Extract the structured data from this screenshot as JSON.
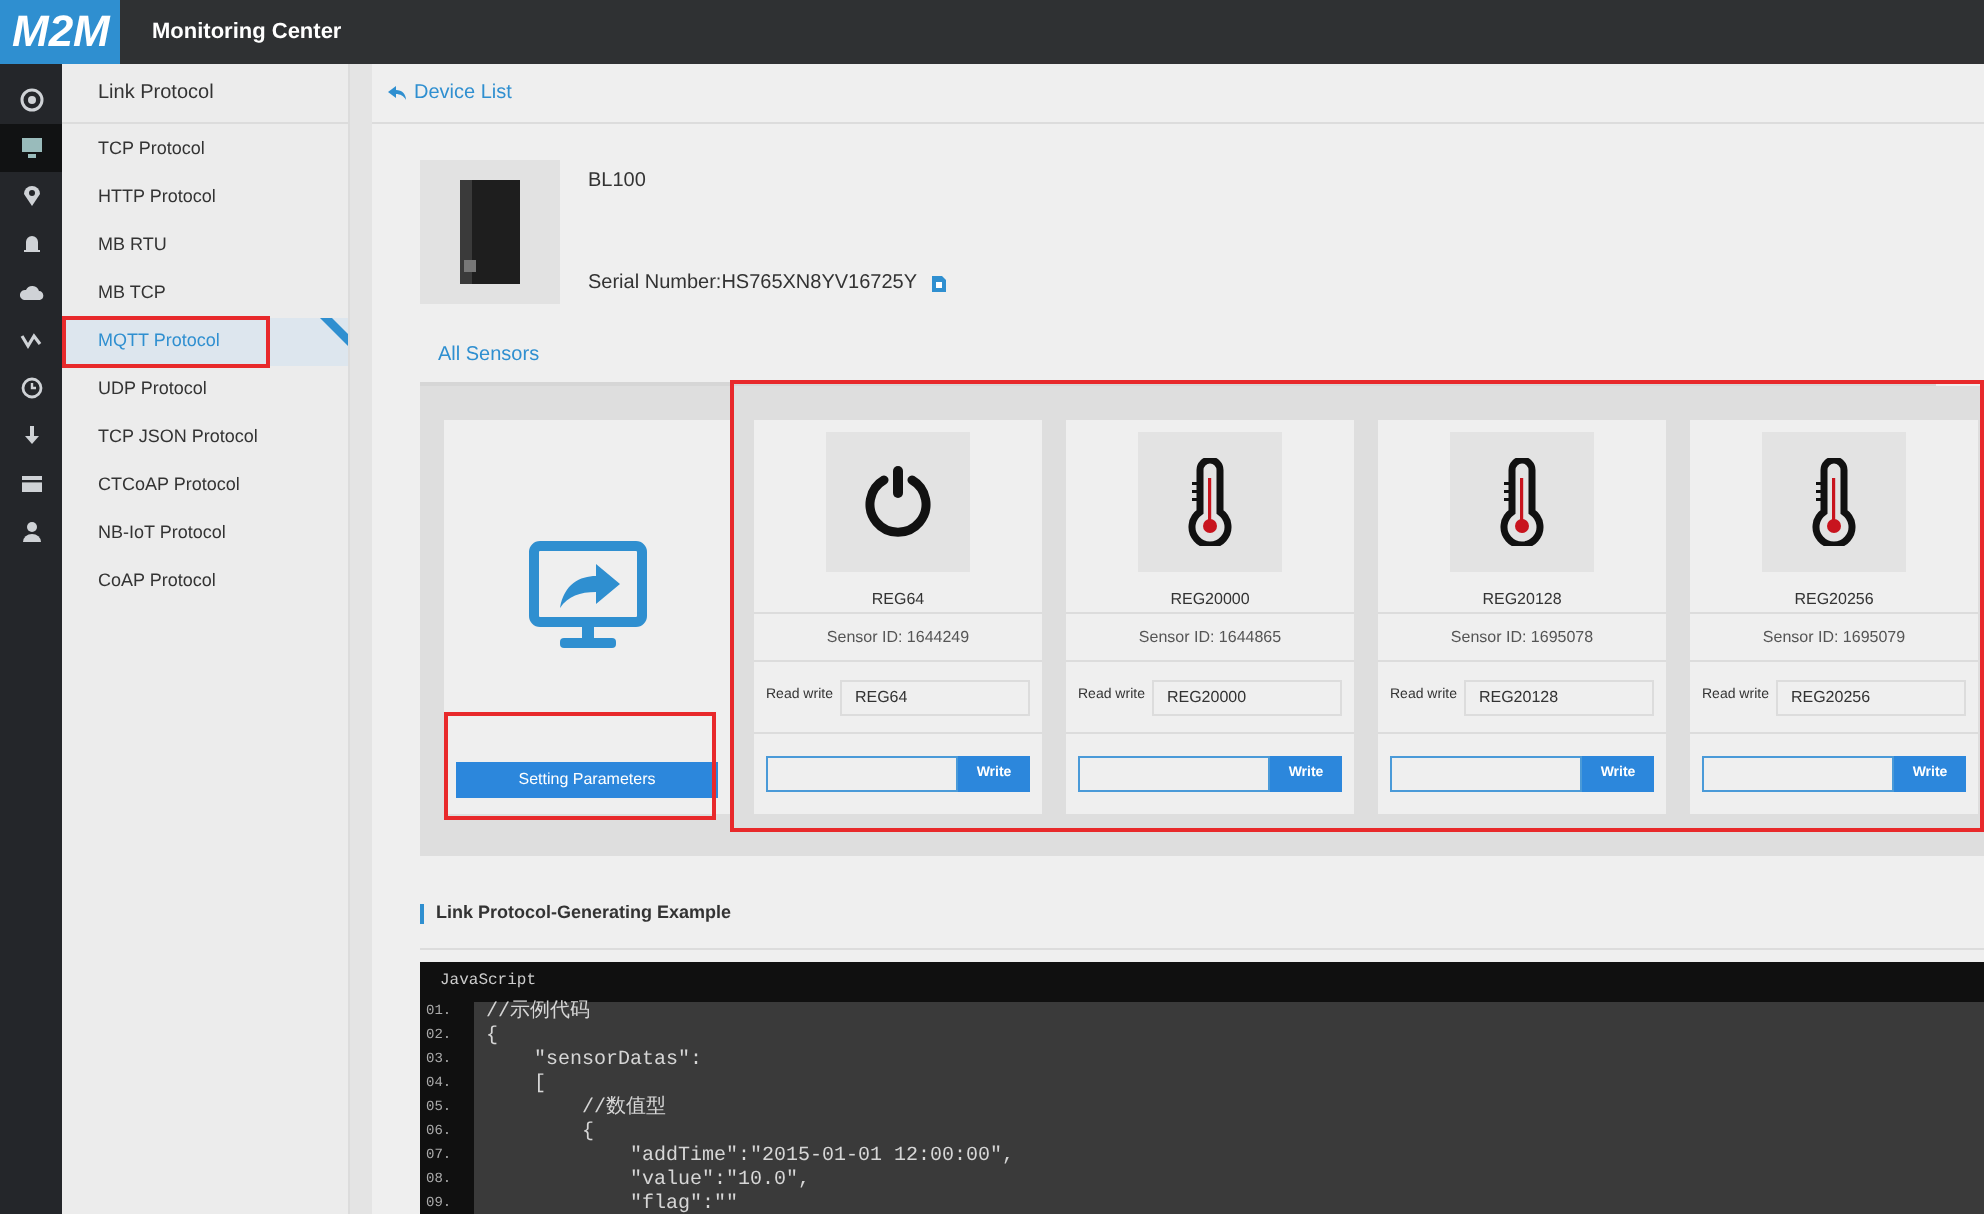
{
  "header": {
    "logo": "M2M",
    "title": "Monitoring Center"
  },
  "rail": [
    {
      "kind": "target",
      "selected": false
    },
    {
      "kind": "monitor",
      "selected": true
    },
    {
      "kind": "pin",
      "selected": false
    },
    {
      "kind": "bell",
      "selected": false
    },
    {
      "kind": "cloud",
      "selected": false
    },
    {
      "kind": "wave",
      "selected": false
    },
    {
      "kind": "clock",
      "selected": false
    },
    {
      "kind": "download",
      "selected": false
    },
    {
      "kind": "card",
      "selected": false
    },
    {
      "kind": "user",
      "selected": false
    }
  ],
  "sidebar": {
    "title": "Link Protocol",
    "items": [
      {
        "label": "TCP Protocol",
        "selected": false,
        "highlighted": false
      },
      {
        "label": "HTTP Protocol",
        "selected": false,
        "highlighted": false
      },
      {
        "label": "MB  RTU",
        "selected": false,
        "highlighted": false
      },
      {
        "label": "MB  TCP",
        "selected": false,
        "highlighted": false
      },
      {
        "label": "MQTT Protocol",
        "selected": true,
        "highlighted": true
      },
      {
        "label": "UDP Protocol",
        "selected": false,
        "highlighted": false
      },
      {
        "label": "TCP JSON Protocol",
        "selected": false,
        "highlighted": false
      },
      {
        "label": "CTCoAP Protocol",
        "selected": false,
        "highlighted": false
      },
      {
        "label": "NB-IoT Protocol",
        "selected": false,
        "highlighted": false
      },
      {
        "label": "CoAP Protocol",
        "selected": false,
        "highlighted": false
      }
    ]
  },
  "back_link": "Device List",
  "device": {
    "name": "BL100",
    "serial": "Serial Number:HS765XN8YV16725Y"
  },
  "tab": "All Sensors",
  "setting": {
    "button": "Setting Parameters",
    "highlighted": true
  },
  "sensors_highlighted": true,
  "sensors": [
    {
      "kind": "power",
      "name": "REG64",
      "sensor_id": "Sensor ID: 1644249",
      "rw_label": "Read write",
      "rw_value": "REG64",
      "write_button": "Write"
    },
    {
      "kind": "temperature",
      "name": "REG20000",
      "sensor_id": "Sensor ID: 1644865",
      "rw_label": "Read write",
      "rw_value": "REG20000",
      "write_button": "Write"
    },
    {
      "kind": "temperature",
      "name": "REG20128",
      "sensor_id": "Sensor ID: 1695078",
      "rw_label": "Read write",
      "rw_value": "REG20128",
      "write_button": "Write"
    },
    {
      "kind": "temperature",
      "name": "REG20256",
      "sensor_id": "Sensor ID: 1695079",
      "rw_label": "Read write",
      "rw_value": "REG20256",
      "write_button": "Write"
    }
  ],
  "example": {
    "title": "Link Protocol-Generating Example",
    "language": "JavaScript",
    "lines": [
      {
        "number": "01.",
        "code": "//示例代码"
      },
      {
        "number": "02.",
        "code": "{"
      },
      {
        "number": "03.",
        "code": "    \"sensorDatas\":"
      },
      {
        "number": "04.",
        "code": "    ["
      },
      {
        "number": "05.",
        "code": "        //数值型"
      },
      {
        "number": "06.",
        "code": "        {"
      },
      {
        "number": "07.",
        "code": "            \"addTime\":\"2015-01-01 12:00:00\","
      },
      {
        "number": "08.",
        "code": "            \"value\":\"10.0\","
      },
      {
        "number": "09.",
        "code": "            \"flag\":\"\""
      }
    ]
  }
}
